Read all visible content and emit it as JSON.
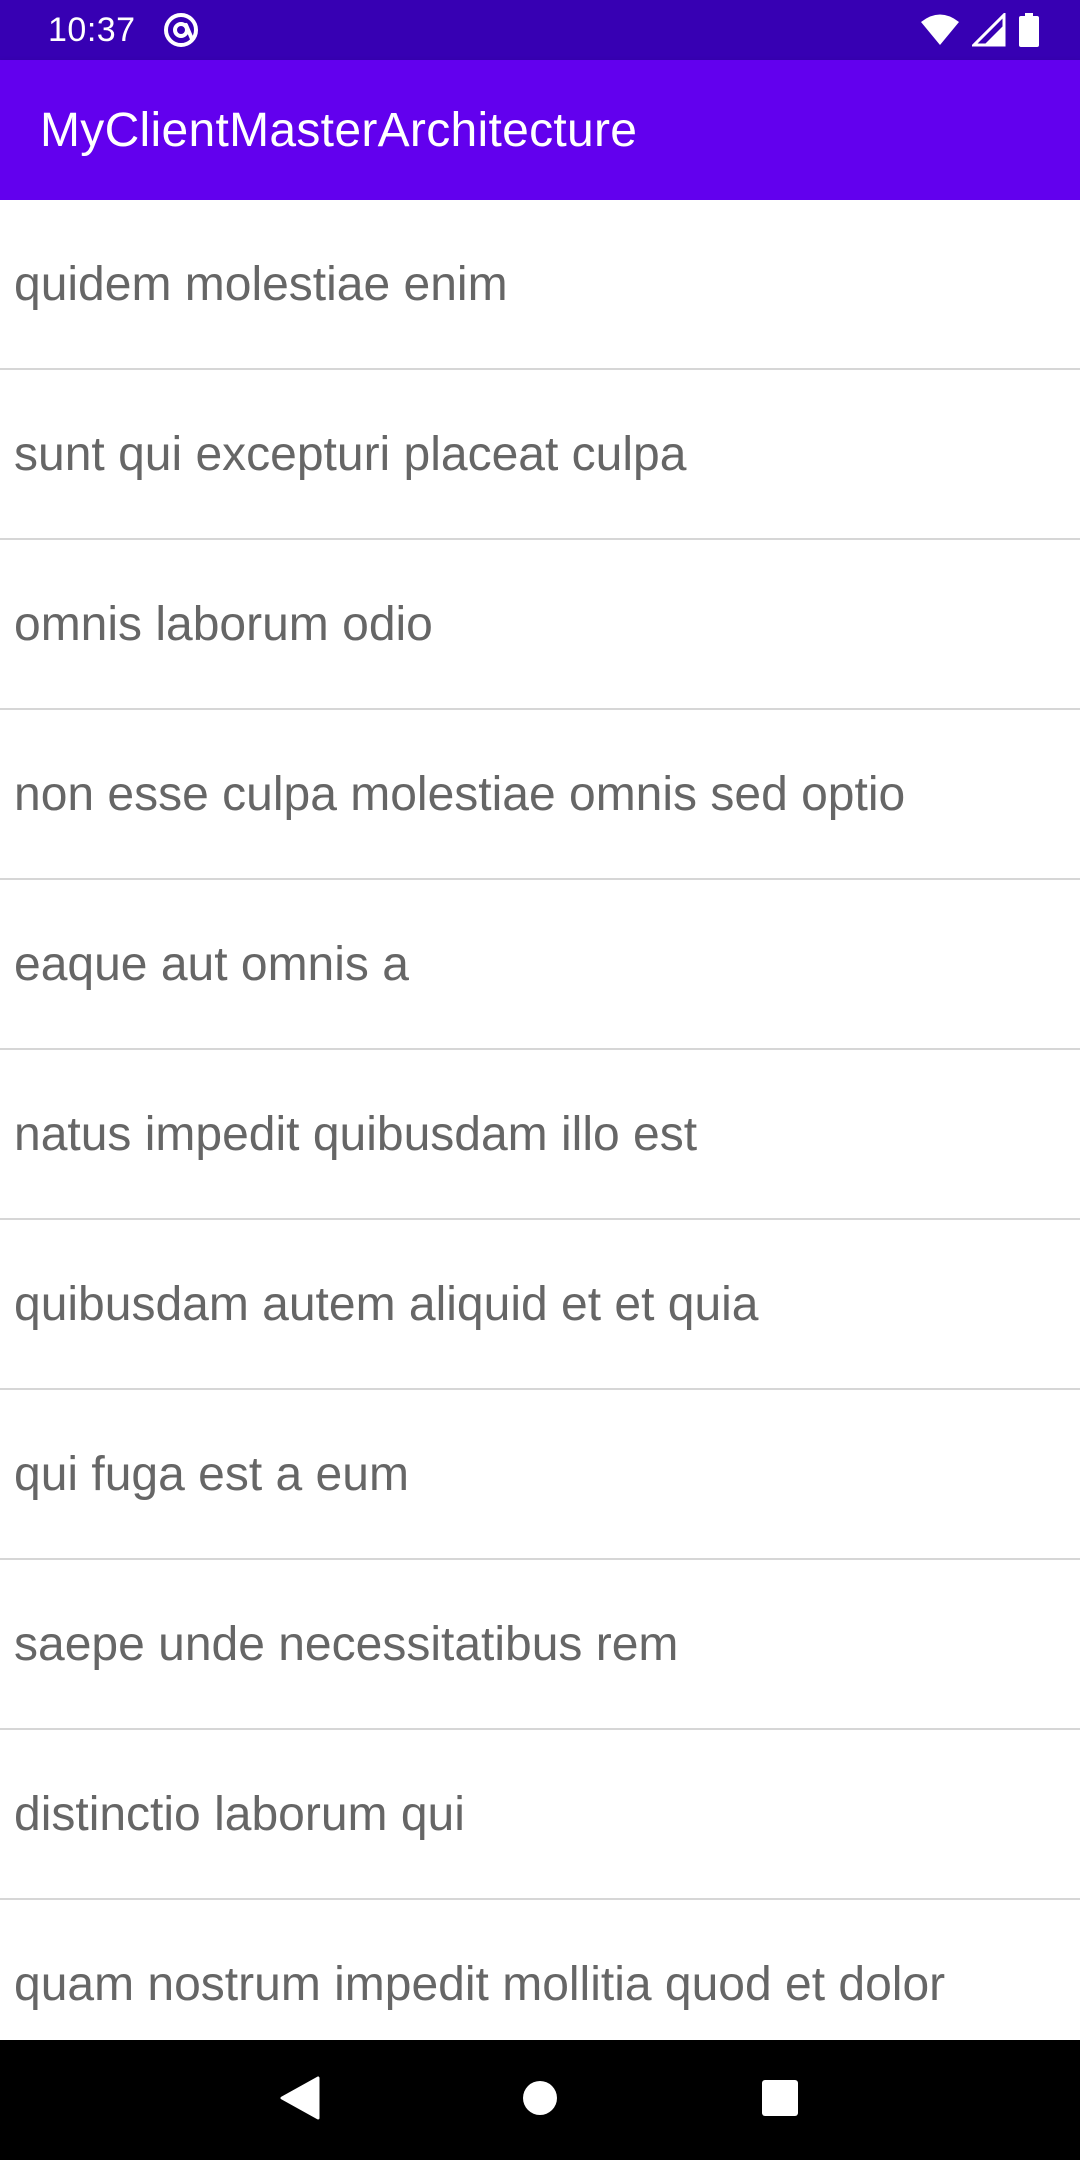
{
  "status_bar": {
    "time": "10:37",
    "icons": [
      "at-sign-icon",
      "wifi-icon",
      "signal-icon",
      "battery-icon"
    ]
  },
  "app_bar": {
    "title": "MyClientMasterArchitecture"
  },
  "list": {
    "items": [
      "quidem molestiae enim",
      "sunt qui excepturi placeat culpa",
      "omnis laborum odio",
      "non esse culpa molestiae omnis sed optio",
      "eaque aut omnis a",
      "natus impedit quibusdam illo est",
      "quibusdam autem aliquid et et quia",
      "qui fuga est a eum",
      "saepe unde necessitatibus rem",
      "distinctio laborum qui",
      "quam nostrum impedit mollitia quod et dolor"
    ]
  },
  "nav_bar": {
    "buttons": [
      "back-icon",
      "home-icon",
      "recents-icon"
    ]
  },
  "colors": {
    "status_bar": "#3700b3",
    "app_bar": "#6200ee",
    "list_text": "#666666",
    "divider": "#d6d6d6",
    "nav_bar": "#000000"
  }
}
